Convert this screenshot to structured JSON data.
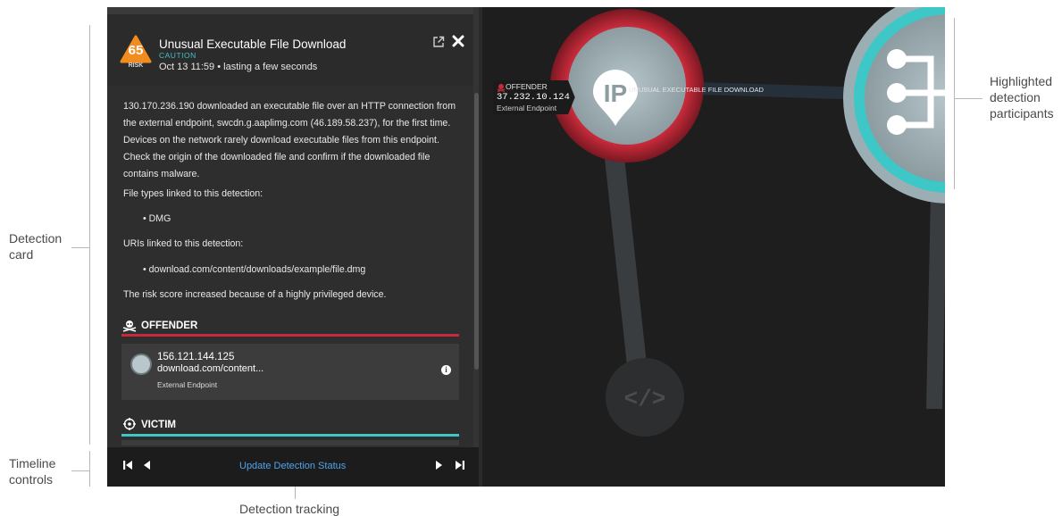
{
  "annotations": {
    "detection_card": [
      "Detection",
      "card"
    ],
    "timeline_controls": [
      "Timeline",
      "controls"
    ],
    "detection_tracking": "Detection tracking",
    "highlighted_participants": [
      "Highlighted",
      "detection",
      "participants"
    ]
  },
  "detection": {
    "risk_score": "65",
    "risk_label": "RISK",
    "title": "Unusual Executable File Download",
    "severity": "CAUTION",
    "time": "Oct 13 11:59 • lasting a few seconds",
    "description": "130.170.236.190 downloaded an executable file over an HTTP connection from the external endpoint, swcdn.g.aaplimg.com (46.189.58.237), for the first time. Devices on the network rarely download executable files from this endpoint. Check the origin of the downloaded file and confirm if the downloaded file contains malware.",
    "file_types_heading": "File types linked to this detection:",
    "file_types": [
      "DMG"
    ],
    "uris_heading": "URIs linked to this detection:",
    "uris": [
      "download.com/content/downloads/example/file.dmg"
    ],
    "risk_note": "The risk score increased because of a highly privileged device."
  },
  "offender_section": {
    "heading": "OFFENDER",
    "ip": "156.121.144.125",
    "host": "download.com/content...",
    "type": "External Endpoint"
  },
  "victim_section": {
    "heading": "VICTIM"
  },
  "timeline": {
    "update_status_label": "Update Detection Status"
  },
  "map": {
    "offender_tag_label": "OFFENDER",
    "offender_tag_ip": "37.232.10.124",
    "offender_tag_type": "External Endpoint",
    "edge_label": "UNUSUAL EXECUTABLE FILE DOWNLOAD",
    "offender_node_text": "IP"
  },
  "colors": {
    "offender_red": "#c62a3a",
    "victim_teal": "#3ec7c7",
    "risk_orange": "#f28c1e",
    "link_blue": "#4fa3ee"
  },
  "icons": [
    "open-external-icon",
    "close-icon",
    "skull-icon",
    "target-icon",
    "info-icon",
    "skip-first-icon",
    "previous-icon",
    "next-icon",
    "skip-last-icon",
    "ip-node-icon",
    "code-node-icon",
    "device-node-icon"
  ]
}
